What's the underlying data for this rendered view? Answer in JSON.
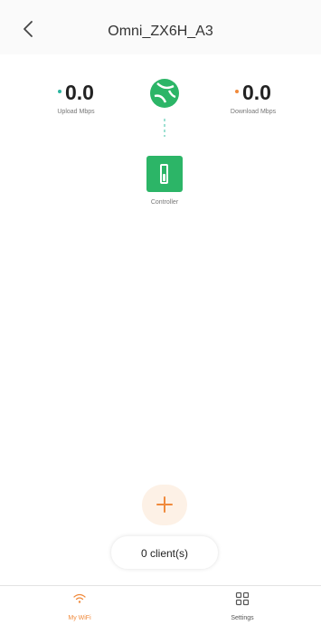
{
  "header": {
    "title": "Omni_ZX6H_A3",
    "back_icon": "chevron-left-icon"
  },
  "stats": {
    "upload": {
      "value": "0.0",
      "label": "Upload Mbps",
      "dot_color": "#2cb5a0"
    },
    "download": {
      "value": "0.0",
      "label": "Download Mbps",
      "dot_color": "#f08a3c"
    }
  },
  "topology": {
    "internet_icon": "globe-icon",
    "controller": {
      "label": "Controller",
      "icon": "controller-device-icon",
      "color": "#2cb567"
    }
  },
  "clients": {
    "add_icon": "plus-icon",
    "count_label": "0 client(s)"
  },
  "bottom_nav": {
    "items": [
      {
        "label": "My WiFi",
        "icon": "wifi-icon",
        "active": true
      },
      {
        "label": "Settings",
        "icon": "grid-icon",
        "active": false
      }
    ]
  },
  "colors": {
    "accent": "#f08a3c",
    "brand_green": "#2cb567"
  }
}
